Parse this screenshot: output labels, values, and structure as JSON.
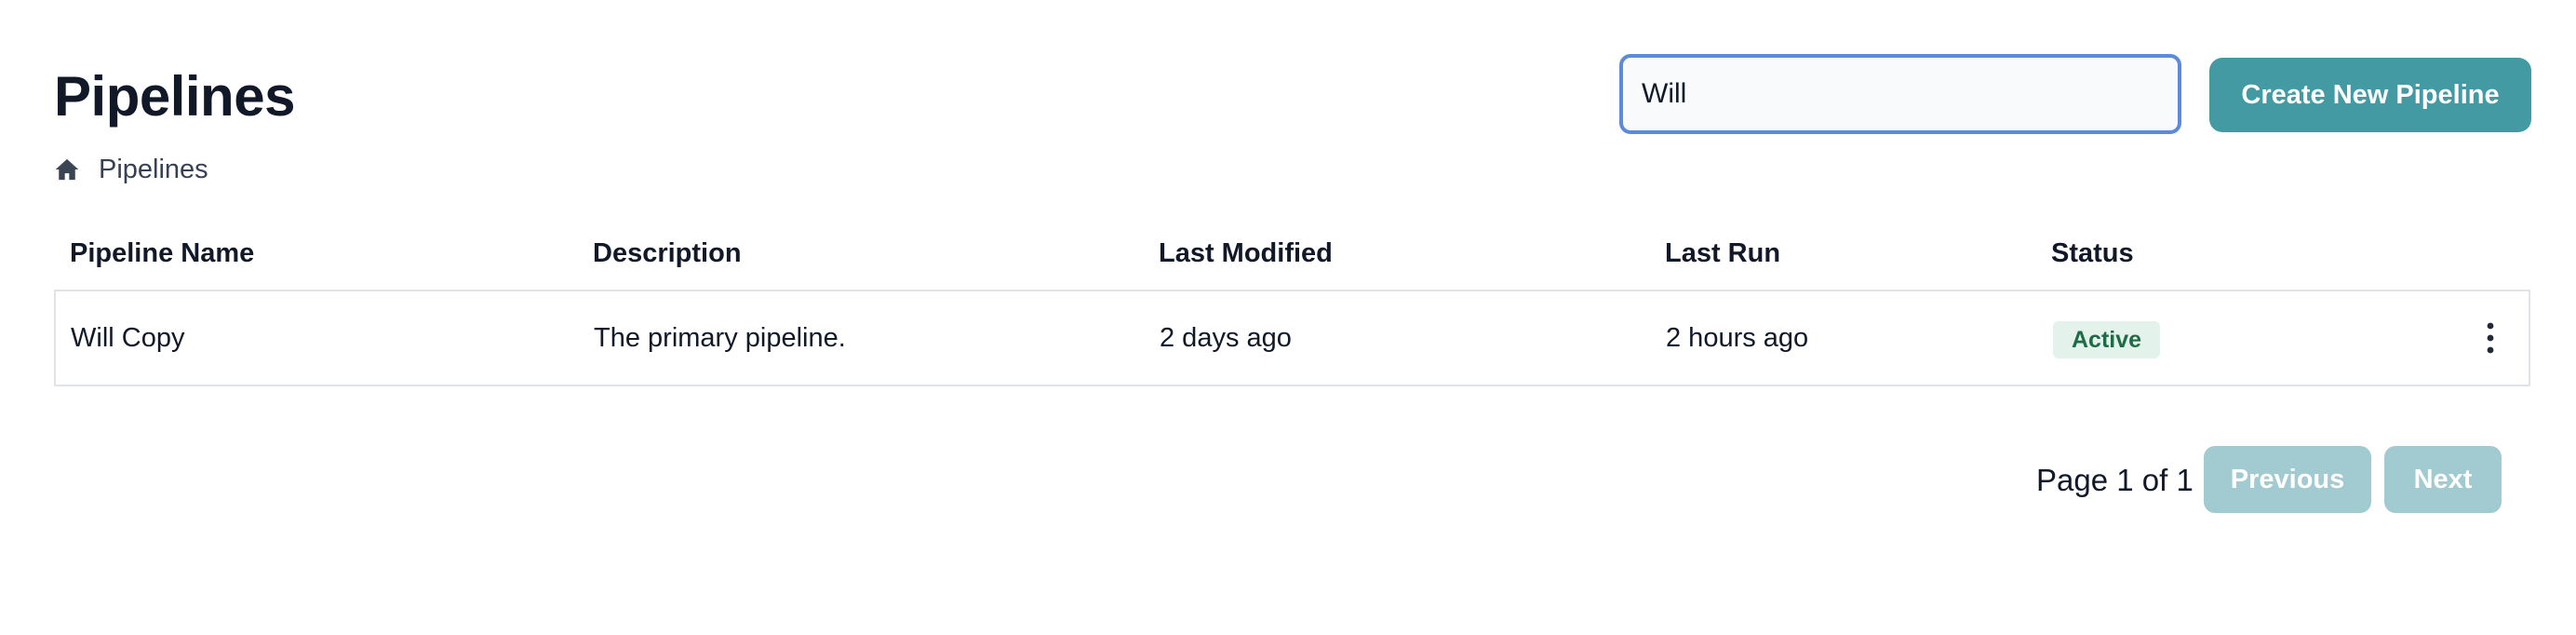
{
  "header": {
    "title": "Pipelines",
    "breadcrumb": [
      {
        "icon": "home-icon",
        "label": "Pipelines"
      }
    ]
  },
  "search": {
    "value": "Will",
    "placeholder": ""
  },
  "toolbar": {
    "create_label": "Create New Pipeline"
  },
  "table": {
    "columns": [
      "Pipeline Name",
      "Description",
      "Last Modified",
      "Last Run",
      "Status"
    ],
    "rows": [
      {
        "name": "Will Copy",
        "description": "The primary pipeline.",
        "last_modified": "2 days ago",
        "last_run": "2 hours ago",
        "status": "Active",
        "menu_icon": "vertical-ellipsis-icon"
      }
    ]
  },
  "pagination": {
    "text": "Page 1 of 1",
    "previous_label": "Previous",
    "next_label": "Next",
    "previous_disabled": true,
    "next_disabled": true
  },
  "colors": {
    "accent": "#449aa3",
    "accent_disabled": "#a1cbd0",
    "focus_border": "#5b8bd9",
    "status_active_bg": "#e3f3ec",
    "status_active_text": "#1f6b45"
  }
}
